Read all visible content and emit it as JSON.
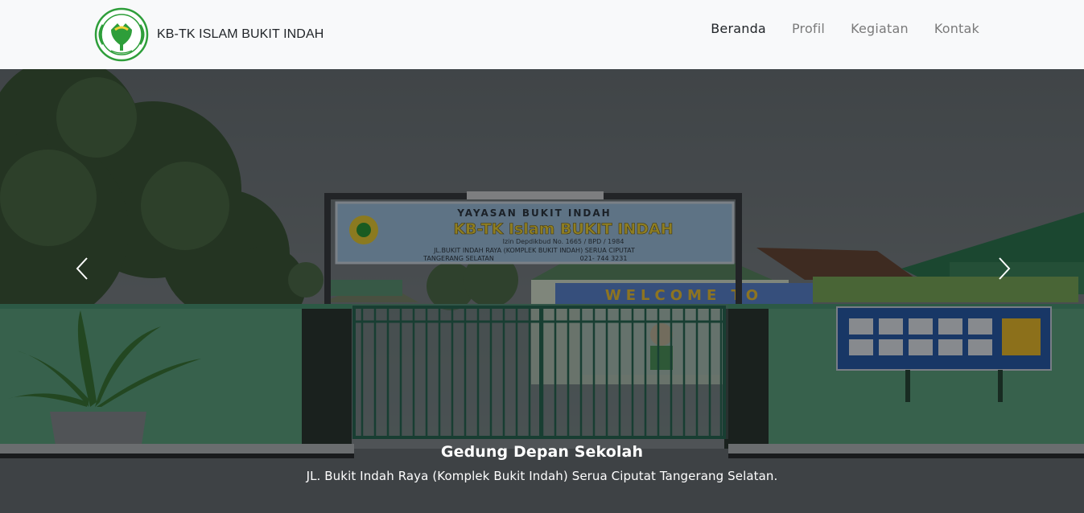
{
  "brand": {
    "name": "KB-TK ISLAM BUKIT INDAH",
    "logo_icon": "school-emblem-icon"
  },
  "nav": [
    {
      "label": "Beranda",
      "active": true
    },
    {
      "label": "Profil",
      "active": false
    },
    {
      "label": "Kegiatan",
      "active": false
    },
    {
      "label": "Kontak",
      "active": false
    }
  ],
  "carousel": {
    "slide": {
      "title": "Gedung Depan Sekolah",
      "description": "JL. Bukit Indah Raya (Komplek Bukit Indah) Serua Ciputat Tangerang Selatan.",
      "sign": {
        "top": "YAYASAN BUKIT INDAH",
        "name": "KB-TK Islam BUKIT INDAH",
        "permit": "Izin Depdikbud No. 1665 / BPD / 1984",
        "address": "JL.BUKIT INDAH RAYA (KOMPLEK BUKIT INDAH) SERUA CIPUTAT",
        "city": "TANGERANG SELATAN",
        "phone": "021- 744 3231"
      },
      "banner": "WELCOME TO"
    },
    "prev_icon": "chevron-left-icon",
    "next_icon": "chevron-right-icon"
  },
  "colors": {
    "brand_green": "#2e9e3a",
    "wall_green": "#5fa884",
    "nav_bg": "#f8f9fa"
  }
}
